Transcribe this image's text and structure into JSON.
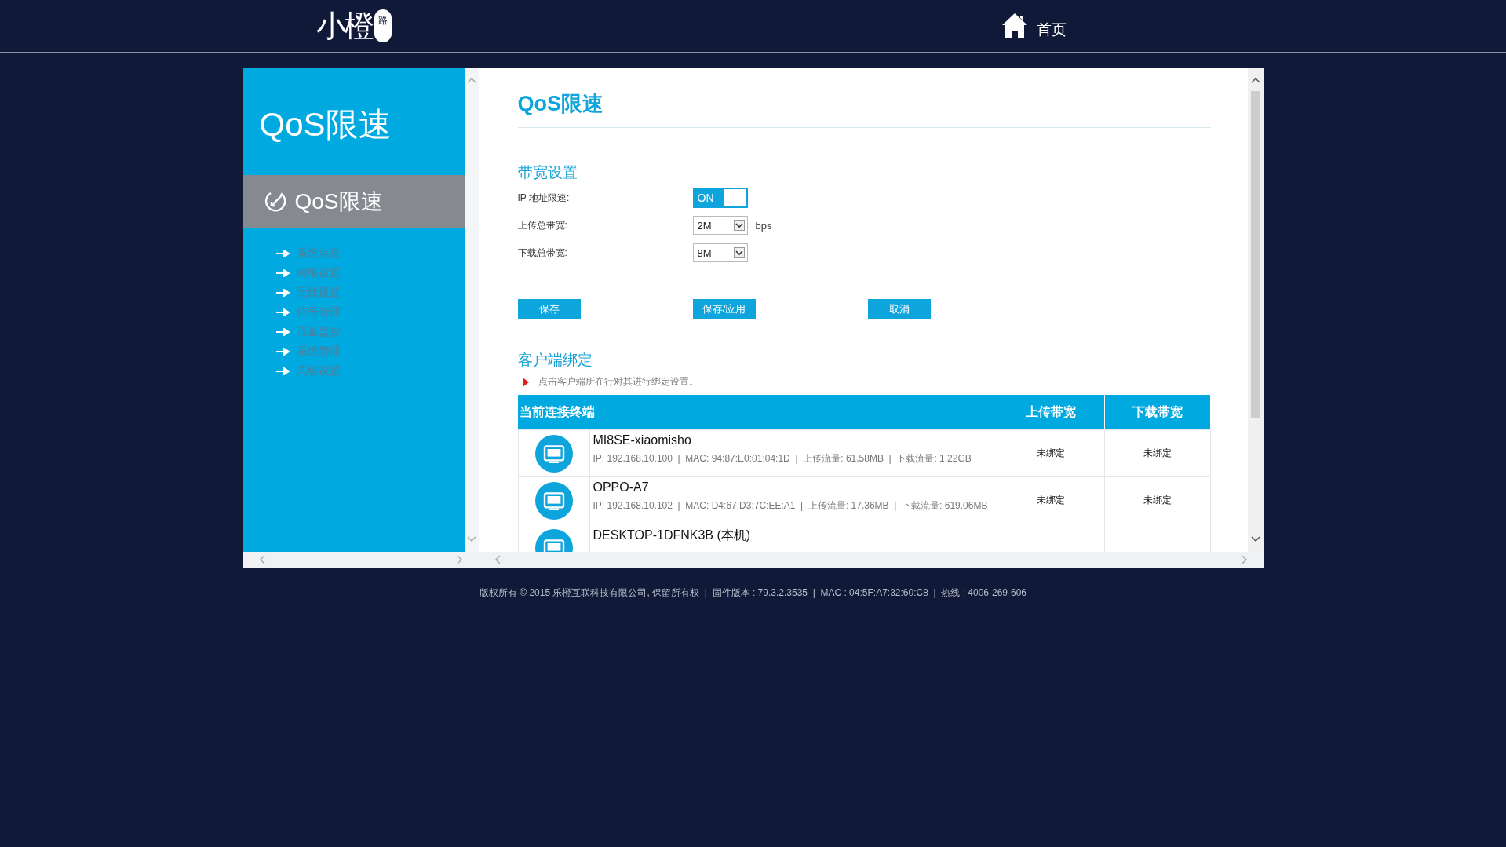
{
  "header": {
    "logo": {
      "text": "小橙",
      "badge": "路"
    },
    "nav": [
      {
        "label": "首页"
      }
    ]
  },
  "sidebar": {
    "title": "QoS限速",
    "active_item": {
      "label": "QoS限速"
    },
    "items": [
      {
        "label": "系统信息"
      },
      {
        "label": "网络设置"
      },
      {
        "label": "无线设置"
      },
      {
        "label": "信号管理"
      },
      {
        "label": "流量监控"
      },
      {
        "label": "系统管理"
      },
      {
        "label": "高级设置"
      }
    ]
  },
  "page": {
    "title": "QoS限速",
    "bandwidth": {
      "heading": "带宽设置",
      "fields": [
        {
          "kind": "toggle",
          "label": "IP 地址限速:",
          "value": "ON",
          "on": true
        },
        {
          "kind": "select",
          "label": "上传总带宽:",
          "value": "2M",
          "unit": "bps"
        },
        {
          "kind": "select",
          "label": "下载总带宽:",
          "value": "8M"
        }
      ]
    },
    "buttons": [
      "保存",
      "保存/应用",
      "取消"
    ],
    "clients": {
      "heading": "客户端绑定",
      "hint": "点击客户端所在行对其进行绑定设置。",
      "table": {
        "columns": [
          "当前连接终端",
          "上传带宽",
          "下载带宽"
        ],
        "rows": [
          {
            "name": "MI8SE-xiaomisho",
            "details": "IP: 192.168.10.100  |  MAC: 94:87:E0:01:04:1D  |  上传流量: 61.58MB  |  下载流量: 1.22GB",
            "upload": "未绑定",
            "download": "未绑定"
          },
          {
            "name": "OPPO-A7",
            "details": "IP: 192.168.10.102  |  MAC: D4:67:D3:7C:EE:A1  |  上传流量: 17.36MB  |  下载流量: 619.06MB",
            "upload": "未绑定",
            "download": "未绑定"
          },
          {
            "name": "DESKTOP-1DFNK3B (本机)"
          }
        ]
      }
    }
  },
  "footer": "版权所有 © 2015 乐橙互联科技有限公司, 保留所有权  |  固件版本 : 79.3.2.3535  |  MAC : 04:5F:A7:32:60:C8  |  热线 : 4006-269-606"
}
